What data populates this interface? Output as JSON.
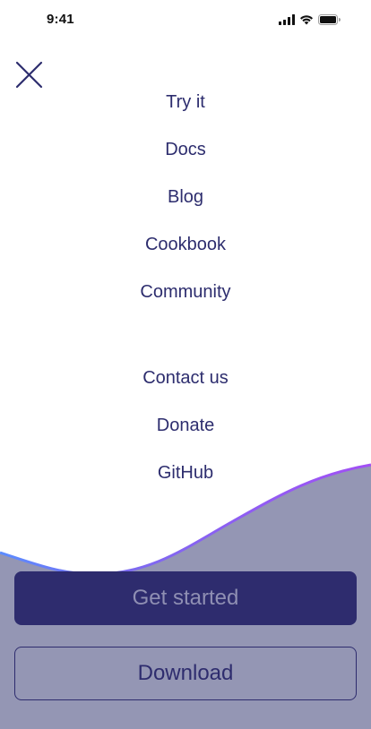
{
  "status_bar": {
    "time": "9:41",
    "icons": [
      "cellular-signal-icon",
      "wifi-icon",
      "battery-icon"
    ]
  },
  "nav": {
    "close_icon": "close-icon",
    "primary_items": [
      {
        "label": "Try it"
      },
      {
        "label": "Docs"
      },
      {
        "label": "Blog"
      },
      {
        "label": "Cookbook"
      },
      {
        "label": "Community"
      }
    ],
    "secondary_items": [
      {
        "label": "Contact us"
      },
      {
        "label": "Donate"
      },
      {
        "label": "GitHub"
      }
    ]
  },
  "actions": {
    "get_started_label": "Get started",
    "download_label": "Download"
  },
  "colors": {
    "text_primary": "#2d2d6e",
    "button_fill": "#2e2c6e",
    "button_fill_text": "#8f8fb3",
    "wave_fill": "#9496b4",
    "wave_stroke_start": "#5b8cff",
    "wave_stroke_end": "#a24ff5"
  }
}
